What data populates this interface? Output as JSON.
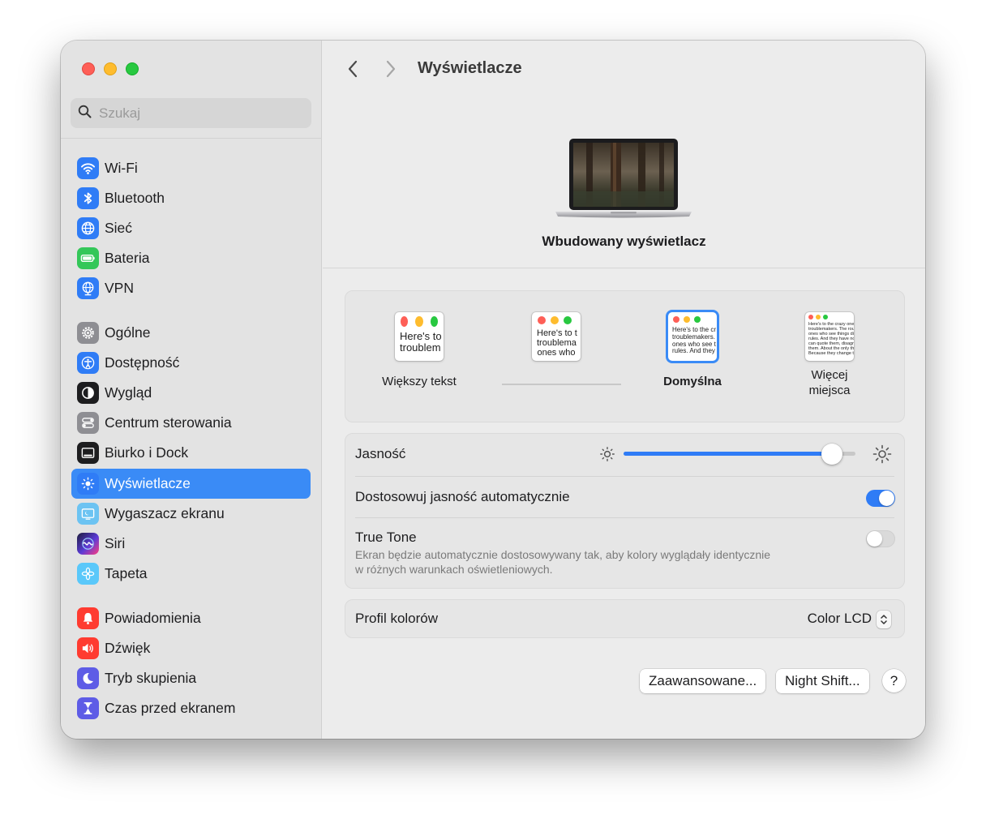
{
  "window": {
    "title": "Wyświetlacze"
  },
  "search": {
    "placeholder": "Szukaj",
    "value": ""
  },
  "sidebar": {
    "items": [
      {
        "label": "Wi-Fi",
        "icon": "wifi-icon",
        "color": "#2f7cf6"
      },
      {
        "label": "Bluetooth",
        "icon": "bluetooth-icon",
        "color": "#2f7cf6"
      },
      {
        "label": "Sieć",
        "icon": "globe-icon",
        "color": "#2f7cf6"
      },
      {
        "label": "Bateria",
        "icon": "battery-icon",
        "color": "#34c759"
      },
      {
        "label": "VPN",
        "icon": "vpn-globe-icon",
        "color": "#2f7cf6"
      },
      {
        "label": "Ogólne",
        "icon": "gear-icon",
        "color": "#8e8e93"
      },
      {
        "label": "Dostępność",
        "icon": "accessibility-icon",
        "color": "#2f7cf6"
      },
      {
        "label": "Wygląd",
        "icon": "appearance-icon",
        "color": "#1d1d1f"
      },
      {
        "label": "Centrum sterowania",
        "icon": "control-center-icon",
        "color": "#8e8e93"
      },
      {
        "label": "Biurko i Dock",
        "icon": "dock-icon",
        "color": "#1d1d1f"
      },
      {
        "label": "Wyświetlacze",
        "icon": "brightness-icon",
        "color": "#2f7cf6",
        "active": true
      },
      {
        "label": "Wygaszacz ekranu",
        "icon": "screensaver-icon",
        "color": "#6cc3f2"
      },
      {
        "label": "Siri",
        "icon": "siri-icon",
        "color": "#5b3bd6"
      },
      {
        "label": "Tapeta",
        "icon": "wallpaper-icon",
        "color": "#5ac8fa"
      },
      {
        "label": "Powiadomienia",
        "icon": "bell-icon",
        "color": "#ff3b30"
      },
      {
        "label": "Dźwięk",
        "icon": "speaker-icon",
        "color": "#ff3b30"
      },
      {
        "label": "Tryb skupienia",
        "icon": "moon-icon",
        "color": "#5e5ce6"
      },
      {
        "label": "Czas przed ekranem",
        "icon": "hourglass-icon",
        "color": "#5e5ce6"
      }
    ]
  },
  "header": {
    "title": "Wyświetlacze",
    "back_icon": "chevron-left-icon",
    "forward_icon": "chevron-right-icon"
  },
  "display": {
    "name": "Wbudowany wyświetlacz",
    "icon": "laptop-icon"
  },
  "resolution": {
    "options": [
      {
        "label": "Większy tekst",
        "preview": "Here's to\ntroublem"
      },
      {
        "label": "",
        "preview": "Here's to t\ntroublema\nones who"
      },
      {
        "label": "Domyślna",
        "preview": "Here's to the cr\ntroublemakers.\nones who see t\nrules. And they",
        "selected": true
      },
      {
        "label": "Więcej\nmiejsca",
        "preview": "Here's to the crazy ones\ntroublemakers. The rou\nones who see things di\nrules. And they have no\ncan quote them, disagr\nthem. About the only th\nBecause they change th"
      }
    ]
  },
  "brightness": {
    "label": "Jasność",
    "value": 0.9,
    "low_icon": "sun-small-icon",
    "high_icon": "sun-large-icon"
  },
  "auto_brightness": {
    "label": "Dostosowuj jasność automatycznie",
    "enabled": true
  },
  "true_tone": {
    "label": "True Tone",
    "description": "Ekran będzie automatycznie dostosowywany tak, aby kolory wyglądały identycznie\nw różnych warunkach oświetleniowych.",
    "enabled": false
  },
  "color_profile": {
    "label": "Profil kolorów",
    "value": "Color LCD"
  },
  "buttons": {
    "advanced": "Zaawansowane...",
    "night_shift": "Night Shift...",
    "help": "?"
  },
  "colors": {
    "accent": "#2f7cf6",
    "sidebar_selection": "#3a8bf6"
  }
}
